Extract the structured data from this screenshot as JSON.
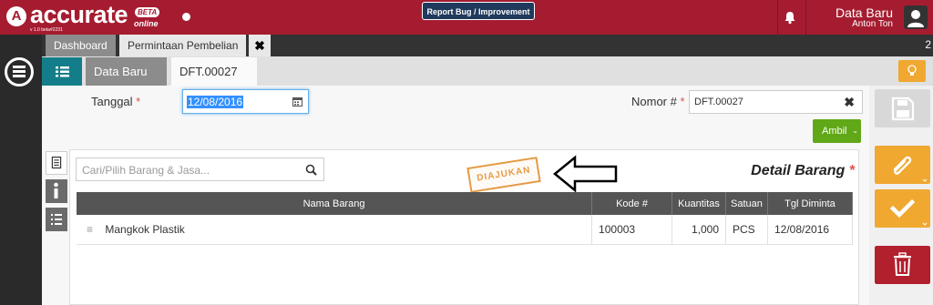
{
  "topbar": {
    "logo_letter": "A",
    "logo_text": "accurate",
    "beta_label": "BETA",
    "online_label": "online",
    "version": "v 1.0 beta#2231",
    "report_button": "Report Bug / Improvement",
    "user_name": "Data Baru",
    "user_sub": "Anton Ton",
    "colors": {
      "brand": "#a51c30",
      "report_bg": "#1f3a5c"
    }
  },
  "tabs": {
    "main": [
      {
        "label": "Dashboard"
      },
      {
        "label": "Permintaan Pembelian"
      }
    ],
    "close_label": "✖",
    "count": "2",
    "sub": [
      {
        "label": "Data Baru",
        "close": "✖"
      },
      {
        "label": "DFT.00027",
        "close": "✖"
      }
    ]
  },
  "form": {
    "tanggal_label": "Tanggal",
    "tanggal_value": "12/08/2016",
    "nomor_label": "Nomor #",
    "nomor_value": "DFT.00027",
    "required_mark": "*",
    "clear_label": "✖",
    "ambil_label": "Ambil",
    "ambil_caret": "⌄"
  },
  "detail": {
    "search_placeholder": "Cari/Pilih Barang & Jasa...",
    "stamp_text": "DIAJUKAN",
    "section_title": "Detail Barang",
    "columns": [
      "Nama Barang",
      "Kode #",
      "Kuantitas",
      "Satuan",
      "Tgl Diminta"
    ],
    "rows": [
      {
        "handle": "≡",
        "nama": "Mangkok Plastik",
        "kode": "100003",
        "kuantitas": "1,000",
        "satuan": "PCS",
        "tgl": "12/08/2016"
      }
    ]
  },
  "icons": {
    "menu": "hamburger-menu-icon",
    "list": "list-icon",
    "bell": "bell-icon",
    "avatar": "user-avatar-icon",
    "bulb": "lightbulb-icon",
    "calendar": "calendar-icon",
    "search": "search-icon",
    "save": "save-icon",
    "attach": "paperclip-icon",
    "approve": "check-icon",
    "delete": "trash-icon"
  },
  "sidebar_colors": {
    "save": "#d8d8d8",
    "attach": "#f0a830",
    "approve": "#f0a830",
    "delete": "#b21f2d"
  }
}
